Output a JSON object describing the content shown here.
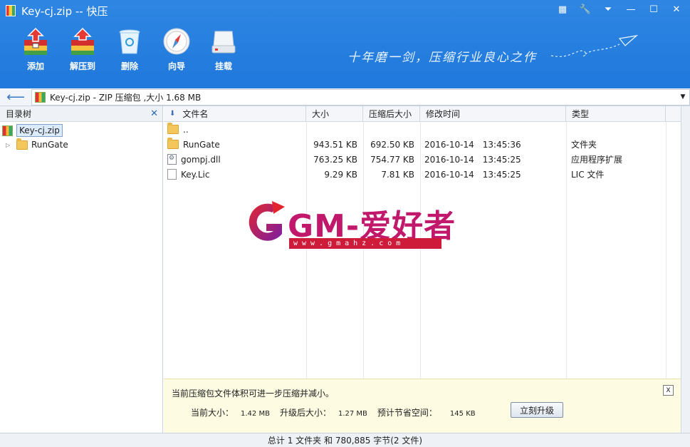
{
  "window": {
    "title": "Key-cj.zip -- 快压"
  },
  "toolbar": {
    "items": [
      {
        "label": "添加",
        "icon": "add-archive-icon"
      },
      {
        "label": "解压到",
        "icon": "extract-icon"
      },
      {
        "label": "删除",
        "icon": "recycle-bin-icon"
      },
      {
        "label": "向导",
        "icon": "compass-icon"
      },
      {
        "label": "挂载",
        "icon": "drive-icon"
      }
    ],
    "slogan": "十年磨一剑，压缩行业良心之作"
  },
  "address": {
    "text": "Key-cj.zip - ZIP 压缩包 ,大小 1.68 MB"
  },
  "tree": {
    "header": "目录树",
    "root": "Key-cj.zip",
    "children": [
      "RunGate"
    ]
  },
  "list": {
    "headers": [
      "文件名",
      "大小",
      "压缩后大小",
      "修改时间",
      "类型"
    ],
    "rows": [
      {
        "name": "..",
        "size": "",
        "packed": "",
        "date": "",
        "time": "",
        "type": "",
        "icon": "folder-icon"
      },
      {
        "name": "RunGate",
        "size": "943.51 KB",
        "packed": "692.50 KB",
        "date": "2016-10-14",
        "time": "13:45:36",
        "type": "文件夹",
        "icon": "folder-icon"
      },
      {
        "name": "gompj.dll",
        "size": "763.25 KB",
        "packed": "754.77 KB",
        "date": "2016-10-14",
        "time": "13:45:25",
        "type": "应用程序扩展",
        "icon": "dll-file-icon"
      },
      {
        "name": "Key.Lic",
        "size": "9.29 KB",
        "packed": "7.81 KB",
        "date": "2016-10-14",
        "time": "13:45:25",
        "type": "LIC 文件",
        "icon": "generic-file-icon"
      }
    ]
  },
  "watermark": {
    "text": "GM-爱好者",
    "url": "www.gmahz.com"
  },
  "notice": {
    "message": "当前压缩包文件体积可进一步压缩并减小。",
    "current_label": "当前大小：",
    "current_value": "1.42 MB",
    "after_label": "升级后大小：",
    "after_value": "1.27 MB",
    "saving_label": "预计节省空间：",
    "saving_value": "145 KB",
    "upgrade_button": "立刻升级",
    "close": "X"
  },
  "status": {
    "text": "总计 1 文件夹 和 780,885 字节(2 文件)"
  }
}
